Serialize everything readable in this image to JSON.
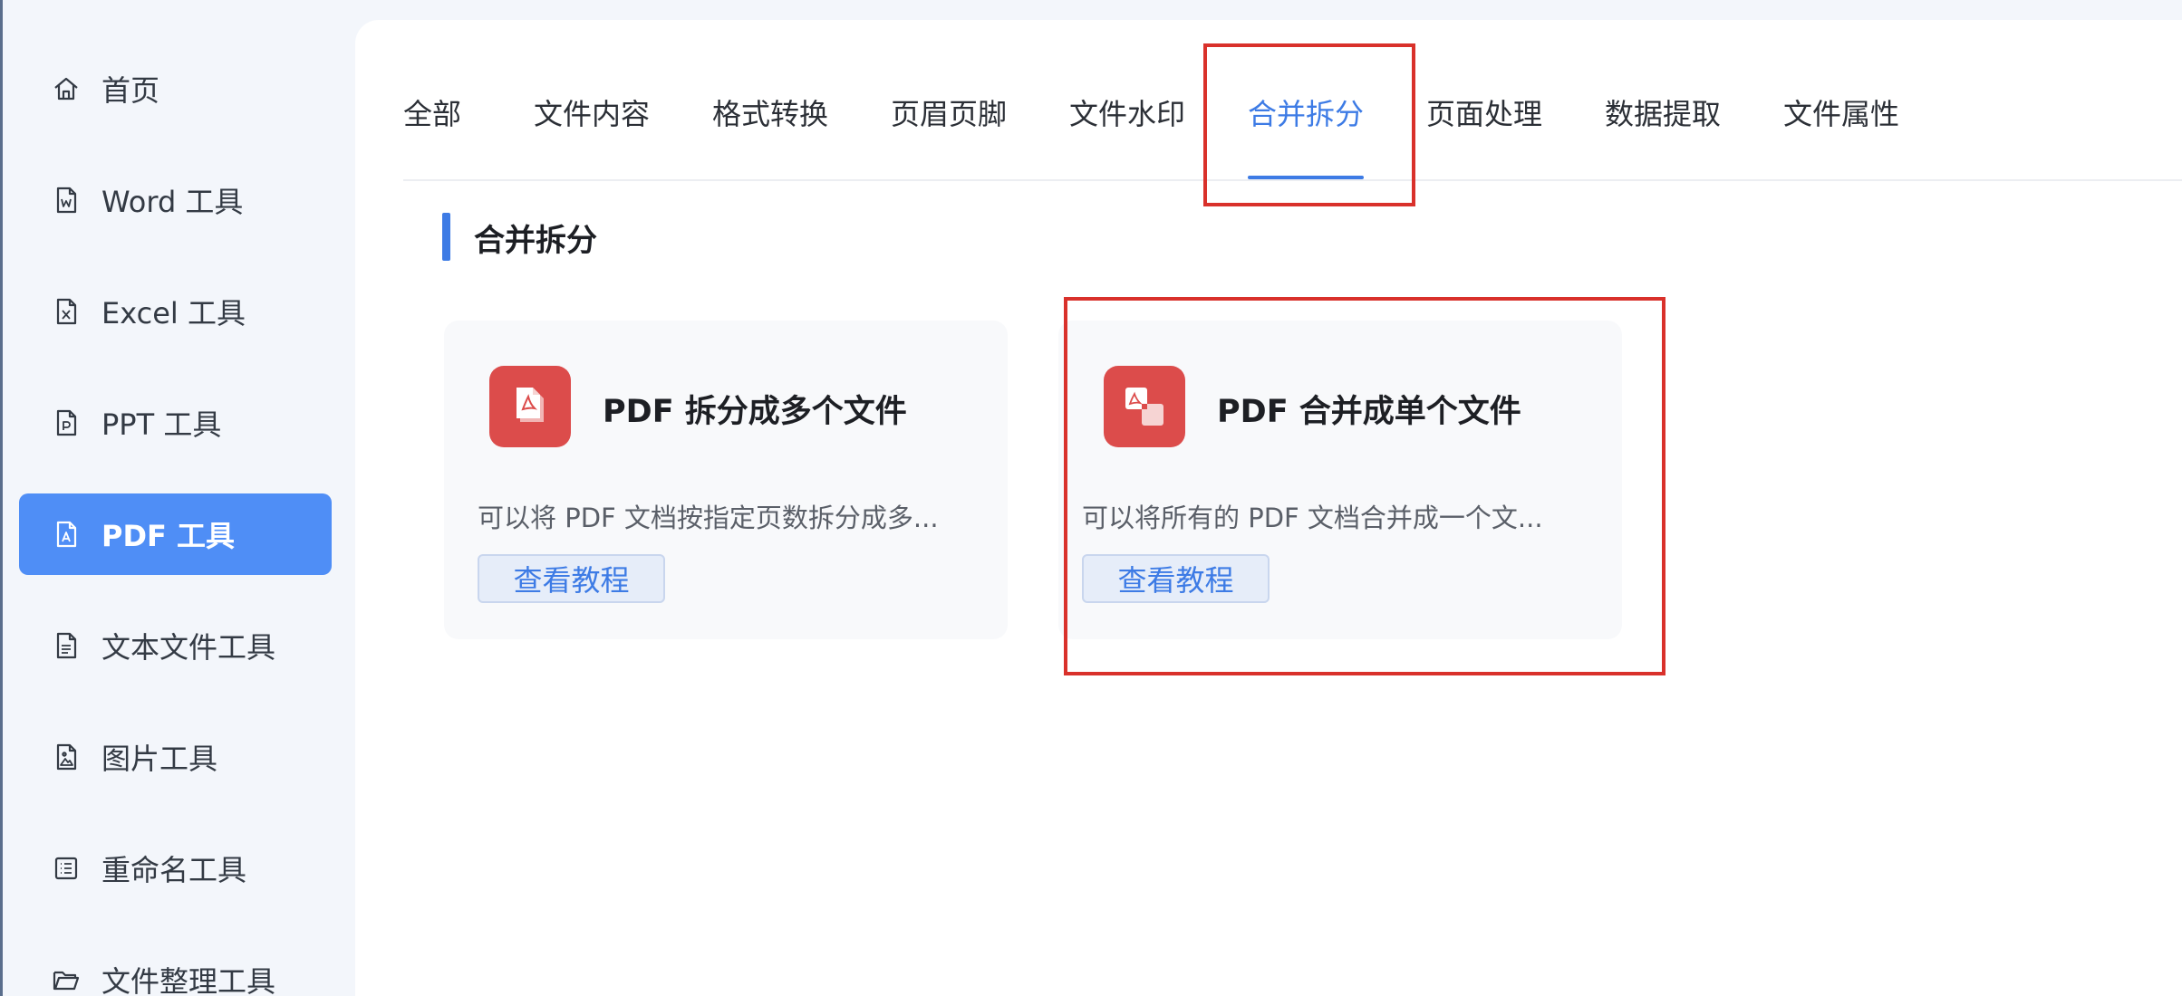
{
  "sidebar": {
    "items": [
      {
        "label": "首页",
        "icon": "home-icon",
        "active": false
      },
      {
        "label": "Word 工具",
        "icon": "word-file-icon",
        "active": false
      },
      {
        "label": "Excel 工具",
        "icon": "excel-file-icon",
        "active": false
      },
      {
        "label": "PPT 工具",
        "icon": "ppt-file-icon",
        "active": false
      },
      {
        "label": "PDF 工具",
        "icon": "pdf-file-icon",
        "active": true
      },
      {
        "label": "文本文件工具",
        "icon": "text-file-icon",
        "active": false
      },
      {
        "label": "图片工具",
        "icon": "image-file-icon",
        "active": false
      },
      {
        "label": "重命名工具",
        "icon": "rename-list-icon",
        "active": false
      },
      {
        "label": "文件整理工具",
        "icon": "folder-icon",
        "active": false
      }
    ]
  },
  "tabs": [
    {
      "label": "全部",
      "active": false
    },
    {
      "label": "文件内容",
      "active": false
    },
    {
      "label": "格式转换",
      "active": false
    },
    {
      "label": "页眉页脚",
      "active": false
    },
    {
      "label": "文件水印",
      "active": false
    },
    {
      "label": "合并拆分",
      "active": true
    },
    {
      "label": "页面处理",
      "active": false
    },
    {
      "label": "数据提取",
      "active": false
    },
    {
      "label": "文件属性",
      "active": false
    }
  ],
  "section": {
    "title": "合并拆分"
  },
  "cards": [
    {
      "title": "PDF 拆分成多个文件",
      "description": "可以将 PDF 文档按指定页数拆分成多...",
      "button_label": "查看教程",
      "icon": "pdf-split-icon"
    },
    {
      "title": "PDF 合并成单个文件",
      "description": "可以将所有的 PDF 文档合并成一个文...",
      "button_label": "查看教程",
      "icon": "pdf-merge-icon"
    }
  ],
  "colors": {
    "accent": "#3d7be5",
    "sidebar_active": "#4f8ef6",
    "card_icon": "#dc4c4b",
    "annotation": "#d9312b"
  }
}
